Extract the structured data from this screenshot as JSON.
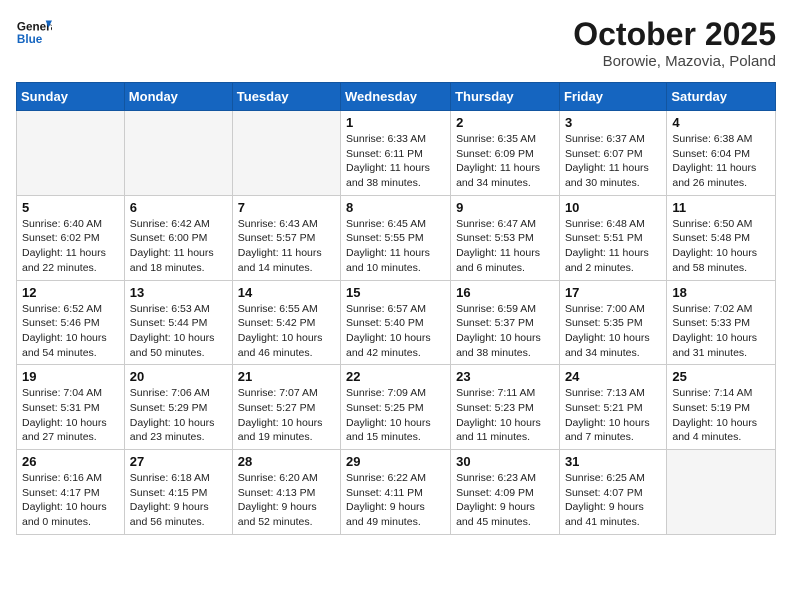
{
  "logo": {
    "line1": "General",
    "line2": "Blue"
  },
  "title": "October 2025",
  "location": "Borowie, Mazovia, Poland",
  "weekdays": [
    "Sunday",
    "Monday",
    "Tuesday",
    "Wednesday",
    "Thursday",
    "Friday",
    "Saturday"
  ],
  "weeks": [
    [
      {
        "day": "",
        "info": ""
      },
      {
        "day": "",
        "info": ""
      },
      {
        "day": "",
        "info": ""
      },
      {
        "day": "1",
        "info": "Sunrise: 6:33 AM\nSunset: 6:11 PM\nDaylight: 11 hours\nand 38 minutes."
      },
      {
        "day": "2",
        "info": "Sunrise: 6:35 AM\nSunset: 6:09 PM\nDaylight: 11 hours\nand 34 minutes."
      },
      {
        "day": "3",
        "info": "Sunrise: 6:37 AM\nSunset: 6:07 PM\nDaylight: 11 hours\nand 30 minutes."
      },
      {
        "day": "4",
        "info": "Sunrise: 6:38 AM\nSunset: 6:04 PM\nDaylight: 11 hours\nand 26 minutes."
      }
    ],
    [
      {
        "day": "5",
        "info": "Sunrise: 6:40 AM\nSunset: 6:02 PM\nDaylight: 11 hours\nand 22 minutes."
      },
      {
        "day": "6",
        "info": "Sunrise: 6:42 AM\nSunset: 6:00 PM\nDaylight: 11 hours\nand 18 minutes."
      },
      {
        "day": "7",
        "info": "Sunrise: 6:43 AM\nSunset: 5:57 PM\nDaylight: 11 hours\nand 14 minutes."
      },
      {
        "day": "8",
        "info": "Sunrise: 6:45 AM\nSunset: 5:55 PM\nDaylight: 11 hours\nand 10 minutes."
      },
      {
        "day": "9",
        "info": "Sunrise: 6:47 AM\nSunset: 5:53 PM\nDaylight: 11 hours\nand 6 minutes."
      },
      {
        "day": "10",
        "info": "Sunrise: 6:48 AM\nSunset: 5:51 PM\nDaylight: 11 hours\nand 2 minutes."
      },
      {
        "day": "11",
        "info": "Sunrise: 6:50 AM\nSunset: 5:48 PM\nDaylight: 10 hours\nand 58 minutes."
      }
    ],
    [
      {
        "day": "12",
        "info": "Sunrise: 6:52 AM\nSunset: 5:46 PM\nDaylight: 10 hours\nand 54 minutes."
      },
      {
        "day": "13",
        "info": "Sunrise: 6:53 AM\nSunset: 5:44 PM\nDaylight: 10 hours\nand 50 minutes."
      },
      {
        "day": "14",
        "info": "Sunrise: 6:55 AM\nSunset: 5:42 PM\nDaylight: 10 hours\nand 46 minutes."
      },
      {
        "day": "15",
        "info": "Sunrise: 6:57 AM\nSunset: 5:40 PM\nDaylight: 10 hours\nand 42 minutes."
      },
      {
        "day": "16",
        "info": "Sunrise: 6:59 AM\nSunset: 5:37 PM\nDaylight: 10 hours\nand 38 minutes."
      },
      {
        "day": "17",
        "info": "Sunrise: 7:00 AM\nSunset: 5:35 PM\nDaylight: 10 hours\nand 34 minutes."
      },
      {
        "day": "18",
        "info": "Sunrise: 7:02 AM\nSunset: 5:33 PM\nDaylight: 10 hours\nand 31 minutes."
      }
    ],
    [
      {
        "day": "19",
        "info": "Sunrise: 7:04 AM\nSunset: 5:31 PM\nDaylight: 10 hours\nand 27 minutes."
      },
      {
        "day": "20",
        "info": "Sunrise: 7:06 AM\nSunset: 5:29 PM\nDaylight: 10 hours\nand 23 minutes."
      },
      {
        "day": "21",
        "info": "Sunrise: 7:07 AM\nSunset: 5:27 PM\nDaylight: 10 hours\nand 19 minutes."
      },
      {
        "day": "22",
        "info": "Sunrise: 7:09 AM\nSunset: 5:25 PM\nDaylight: 10 hours\nand 15 minutes."
      },
      {
        "day": "23",
        "info": "Sunrise: 7:11 AM\nSunset: 5:23 PM\nDaylight: 10 hours\nand 11 minutes."
      },
      {
        "day": "24",
        "info": "Sunrise: 7:13 AM\nSunset: 5:21 PM\nDaylight: 10 hours\nand 7 minutes."
      },
      {
        "day": "25",
        "info": "Sunrise: 7:14 AM\nSunset: 5:19 PM\nDaylight: 10 hours\nand 4 minutes."
      }
    ],
    [
      {
        "day": "26",
        "info": "Sunrise: 6:16 AM\nSunset: 4:17 PM\nDaylight: 10 hours\nand 0 minutes."
      },
      {
        "day": "27",
        "info": "Sunrise: 6:18 AM\nSunset: 4:15 PM\nDaylight: 9 hours\nand 56 minutes."
      },
      {
        "day": "28",
        "info": "Sunrise: 6:20 AM\nSunset: 4:13 PM\nDaylight: 9 hours\nand 52 minutes."
      },
      {
        "day": "29",
        "info": "Sunrise: 6:22 AM\nSunset: 4:11 PM\nDaylight: 9 hours\nand 49 minutes."
      },
      {
        "day": "30",
        "info": "Sunrise: 6:23 AM\nSunset: 4:09 PM\nDaylight: 9 hours\nand 45 minutes."
      },
      {
        "day": "31",
        "info": "Sunrise: 6:25 AM\nSunset: 4:07 PM\nDaylight: 9 hours\nand 41 minutes."
      },
      {
        "day": "",
        "info": ""
      }
    ]
  ]
}
